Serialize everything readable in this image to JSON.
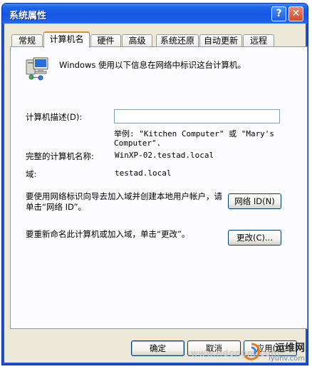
{
  "window": {
    "title": "系统属性",
    "help_glyph": "?",
    "close_glyph": "✕"
  },
  "tabs": [
    {
      "label": "常规"
    },
    {
      "label": "计算机名"
    },
    {
      "label": "硬件"
    },
    {
      "label": "高级"
    },
    {
      "label": "系统还原"
    },
    {
      "label": "自动更新"
    },
    {
      "label": "远程"
    }
  ],
  "active_tab": "计算机名",
  "panel": {
    "icon": "computer-network-icon",
    "intro": "Windows 使用以下信息在网络中标识这台计算机。",
    "description_label": "计算机描述(D):",
    "description_value": "",
    "example": "举例: \"Kitchen Computer\" 或 \"Mary's Computer\".",
    "full_name_label": "完整的计算机名称:",
    "full_name_value": "WinXP-02.testad.local",
    "domain_label": "域:",
    "domain_value": "testad.local",
    "network_id_text": "要使用网络标识向导去加入域并创建本地用户帐户，请单击“网络 ID”。",
    "network_id_button": "网络 ID(N)",
    "rename_text": "要重新命名此计算机或加入域，单击“更改”。",
    "change_button": "更改(C)..."
  },
  "footer": {
    "ok": "确定",
    "cancel": "取消",
    "apply": "应用(A)"
  },
  "watermark": {
    "brand": "运维网",
    "site": "iyunv.com",
    "url": "www.iidongm.com"
  },
  "colors": {
    "titlebar": "#1f5be6",
    "dialog_bg": "#ece9d8",
    "active_tab_accent": "#e68b2c",
    "button_border": "#003c74"
  }
}
